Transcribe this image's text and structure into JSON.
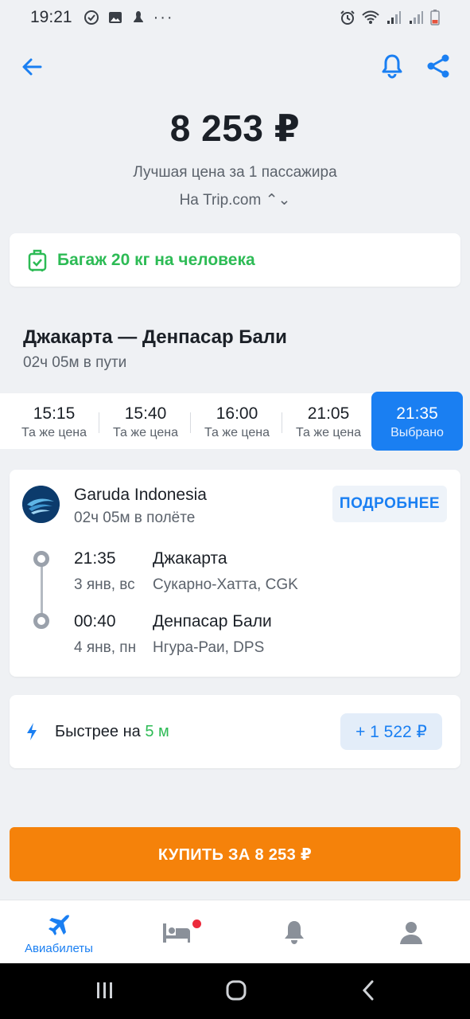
{
  "status_bar": {
    "time": "19:21"
  },
  "header": {
    "price": "8 253 ₽",
    "subtitle": "Лучшая цена за 1 пассажира",
    "source": "На Trip.com ⌃⌄"
  },
  "baggage": {
    "text": "Багаж 20 кг на человека"
  },
  "route": {
    "title": "Джакарта — Денпасар Бали",
    "duration": "02ч 05м в пути"
  },
  "time_options": [
    {
      "time": "15:15",
      "label": "Та же цена"
    },
    {
      "time": "15:40",
      "label": "Та же цена"
    },
    {
      "time": "16:00",
      "label": "Та же цена"
    },
    {
      "time": "21:05",
      "label": "Та же цена"
    },
    {
      "time": "21:35",
      "label": "Выбрано"
    }
  ],
  "flight": {
    "airline": "Garuda Indonesia",
    "flight_duration": "02ч 05м в полёте",
    "details_button": "ПОДРОБНЕЕ",
    "departure": {
      "time": "21:35",
      "date": "3 янв, вс",
      "city": "Джакарта",
      "airport": "Сукарно-Хатта, CGK"
    },
    "arrival": {
      "time": "00:40",
      "date": "4 янв, пн",
      "city": "Денпасар Бали",
      "airport": "Нгура-Раи, DPS"
    }
  },
  "faster": {
    "prefix": "Быстрее на ",
    "amount": "5 м",
    "extra_price": "+ 1 522 ₽"
  },
  "buy_button": {
    "label": "КУПИТЬ ЗА 8 253 ₽"
  },
  "tabbar": {
    "flights_label": "Авиабилеты"
  },
  "colors": {
    "accent": "#1a7ff2",
    "green": "#2dbb55",
    "orange": "#f5820a",
    "red_dot": "#ec2a3c"
  }
}
